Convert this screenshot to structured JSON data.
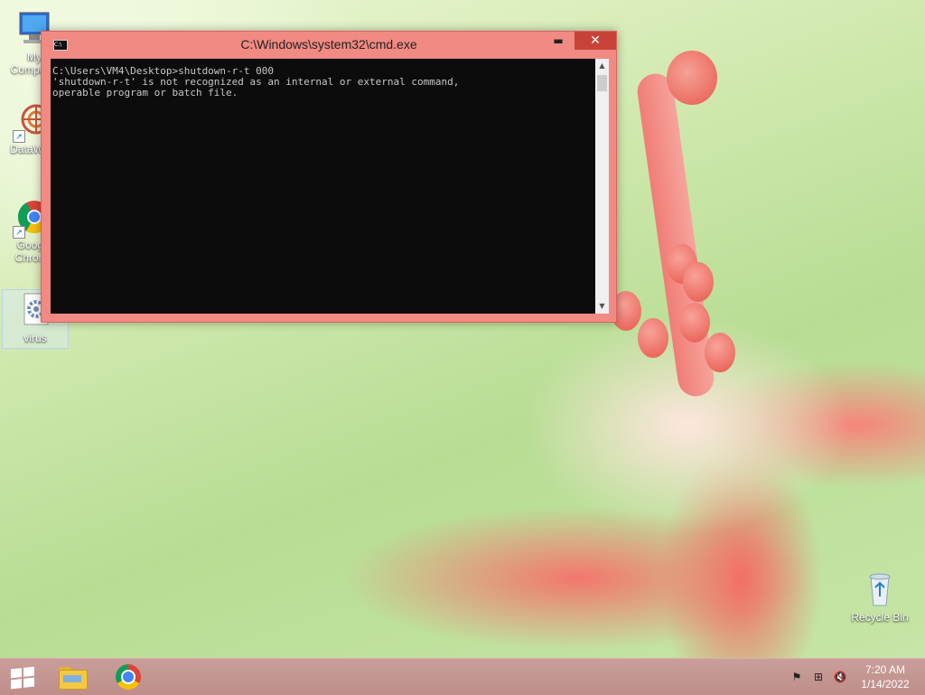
{
  "desktop": {
    "icons": [
      {
        "label": "My Computer"
      },
      {
        "label": "DataWarp"
      },
      {
        "label": "Google Chrome"
      },
      {
        "label": "virus"
      },
      {
        "label": "Recycle Bin"
      }
    ]
  },
  "cmd_window": {
    "title": "C:\\Windows\\system32\\cmd.exe",
    "icon_label": "C:\\",
    "minimize_glyph": "▬",
    "maximize_glyph": "□",
    "close_glyph": "✕",
    "output": "C:\\Users\\VM4\\Desktop>shutdown-r-t 000\n'shutdown-r-t' is not recognized as an internal or external command,\noperable program or batch file.",
    "scroll_up_glyph": "▲",
    "scroll_down_glyph": "▼"
  },
  "taskbar": {
    "start_icon": "windows-logo-icon",
    "pinned": [
      "file-explorer-icon",
      "chrome-icon"
    ],
    "tray": {
      "flag_glyph": "⚑",
      "network_glyph": "⊞",
      "volume_glyph": "🔇"
    },
    "clock": {
      "time": "7:20 AM",
      "date": "1/14/2022"
    }
  },
  "colors": {
    "window_frame": "#f08a82",
    "close_button": "#c7433a",
    "console_bg": "#0c0c0c",
    "taskbar": "#c4948f"
  }
}
